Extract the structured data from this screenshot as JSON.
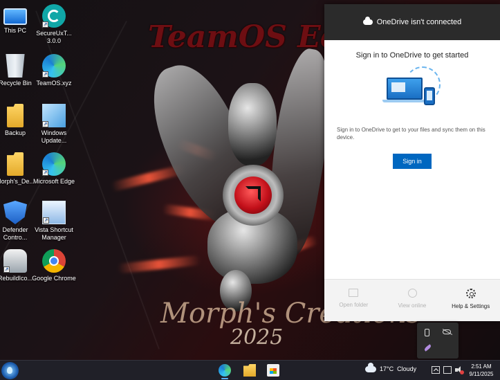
{
  "desktop": {
    "icons": [
      {
        "label": "This PC",
        "icon": "this-pc-icon"
      },
      {
        "label": "SecureUxT...\n3.0.0",
        "icon": "secureux-icon"
      },
      {
        "label": "Recycle Bin",
        "icon": "recycle-bin-icon"
      },
      {
        "label": "TeamOS.xyz",
        "icon": "edge-link-icon"
      },
      {
        "label": "Backup",
        "icon": "folder-icon"
      },
      {
        "label": "Windows Update...",
        "icon": "windows-update-blocker-icon"
      },
      {
        "label": "Morph's_De...",
        "icon": "folder-icon"
      },
      {
        "label": "Microsoft Edge",
        "icon": "edge-icon"
      },
      {
        "label": "Defender Contro...",
        "icon": "defender-shield-icon"
      },
      {
        "label": "Vista Shortcut Manager",
        "icon": "vista-shortcut-manager-icon"
      },
      {
        "label": "RebuildIco...",
        "icon": "robot-icon"
      },
      {
        "label": "Google Chrome",
        "icon": "chrome-icon"
      }
    ]
  },
  "wallpaper": {
    "title_art": "TeamOS Edit",
    "signature_art": "Morph's Creations",
    "year_art": "2025"
  },
  "onedrive": {
    "header_title": "OneDrive isn't connected",
    "heading": "Sign in to OneDrive to get started",
    "description": "Sign in to OneDrive to get to your files and sync them on this device.",
    "signin_button": "Sign in",
    "footer": {
      "open_folder": "Open folder",
      "view_online": "View online",
      "help_settings": "Help & Settings"
    }
  },
  "taskbar": {
    "pinned_apps": [
      "Microsoft Edge",
      "File Explorer",
      "Microsoft Store"
    ],
    "weather": {
      "temperature": "17°C",
      "condition": "Cloudy"
    },
    "clock": {
      "time": "2:51 AM",
      "date": "9/11/2025"
    }
  },
  "colors": {
    "accent_blue": "#0067c0",
    "flyout_header": "#2b2b2b",
    "taskbar_bg": "#202028"
  }
}
